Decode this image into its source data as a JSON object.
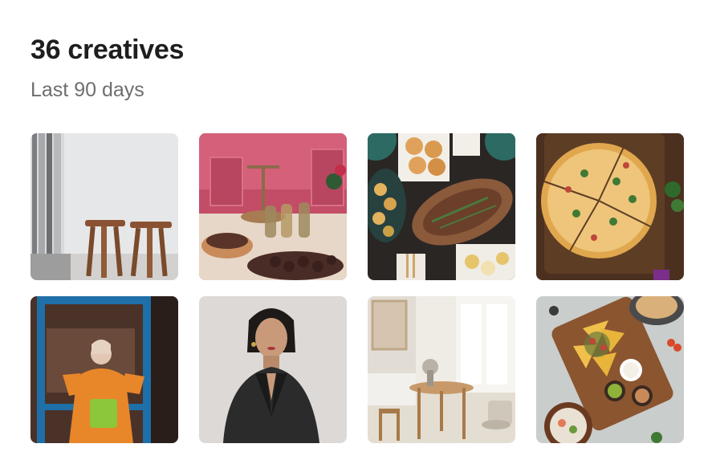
{
  "header": {
    "title": "36 creatives",
    "subtitle": "Last 90 days"
  },
  "creatives": [
    {
      "subject": "minimal-interior-stools",
      "accent": "#e4e5e6"
    },
    {
      "subject": "pink-dessert-table",
      "accent": "#c85068"
    },
    {
      "subject": "roast-fish-spread",
      "accent": "#2c2a28"
    },
    {
      "subject": "pizza-on-board",
      "accent": "#5a3b22"
    },
    {
      "subject": "woman-orange-outfit-blue-frame",
      "accent": "#e8862a"
    },
    {
      "subject": "woman-black-blazer-portrait",
      "accent": "#dcd9d6"
    },
    {
      "subject": "bright-dining-room",
      "accent": "#ece7e0"
    },
    {
      "subject": "nachos-board-topdown",
      "accent": "#c8ccca"
    }
  ]
}
